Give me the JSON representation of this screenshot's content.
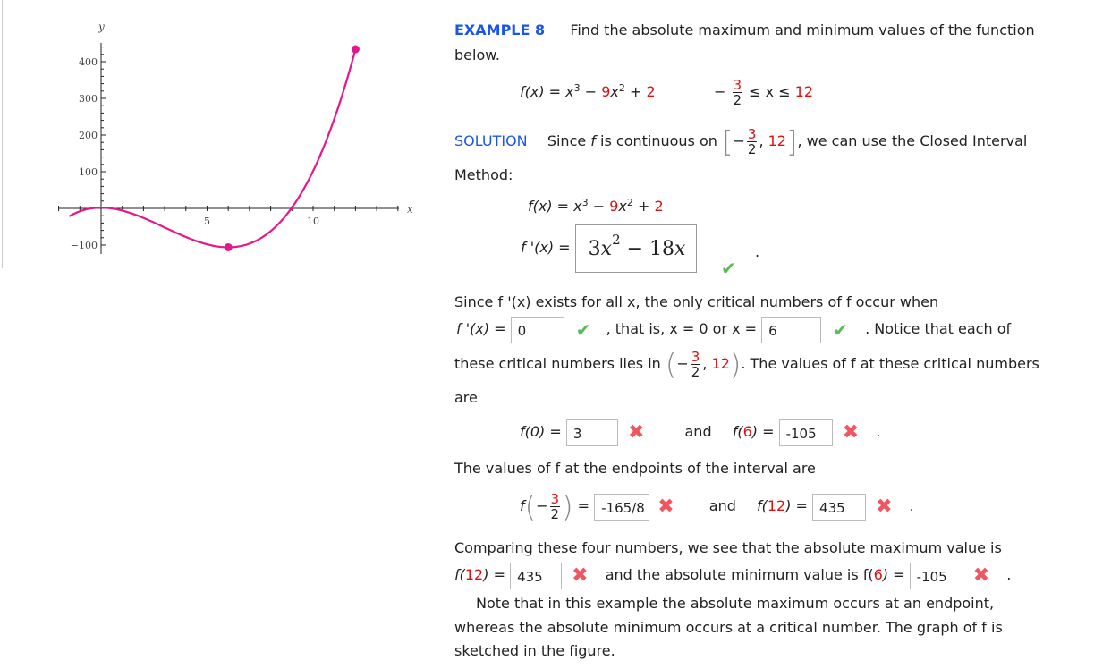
{
  "example": {
    "label": "EXAMPLE 8",
    "prompt_line1": "Find the absolute maximum and minimum values of the function",
    "prompt_line2": "below."
  },
  "function": {
    "lhs": "f(x) = x",
    "exp3": "3",
    "minus": " − ",
    "coef9": "9",
    "x": "x",
    "exp2": "2",
    "plus": " + ",
    "const2": "2",
    "domain_neg": "−",
    "frac_num": "3",
    "frac_den": "2",
    "domain_mid": "≤ x ≤ ",
    "domain_hi": "12"
  },
  "solution": {
    "label": "SOLUTION",
    "text1": "Since ",
    "f": "f",
    "text2": " is continuous on",
    "interval_open": "[",
    "interval_close": "]",
    "interval_hi": "12",
    "text3": ", we can use the Closed Interval",
    "text4": "Method:"
  },
  "derivative": {
    "fx_label": "f(x)",
    "fx_eq": " = ",
    "fprime_label": "f '(x)",
    "fprime_eq": " = ",
    "answer_coef": "3",
    "answer_x": "x",
    "answer_exp": "2",
    "answer_rest": " − 18",
    "answer_x2": "x",
    "status": "correct",
    "period": "."
  },
  "critical": {
    "line1": "Since  f '(x)  exists for all x, the only critical numbers of f occur when",
    "fprime_eq": "f '(x) = ",
    "input1_value": "0",
    "input1_status": "correct",
    "mid_text": ",  that is,  x = 0  or  x = ",
    "input2_value": "6",
    "input2_status": "correct",
    "tail_text": ".  Notice that each of",
    "line3a": "these critical numbers lies in",
    "open_paren": "(",
    "close_paren": ")",
    "interval_hi": "12",
    "line3b": ". The values of f at these critical numbers",
    "line4": "are"
  },
  "values": {
    "f0_label": "f(0) = ",
    "f0_value": "3",
    "f0_status": "incorrect",
    "and1": "and",
    "f6_label_pre": "f(",
    "f6_arg": "6",
    "f6_label_post": ") = ",
    "f6_value": "-105",
    "f6_status": "incorrect",
    "endpoints_text": "The values of f at the endpoints of the interval are",
    "fneg_value": "-165/8",
    "fneg_status": "incorrect",
    "and2": "and",
    "f12_pre": "f(",
    "f12_arg": "12",
    "f12_post": ") = ",
    "f12_value": "435",
    "f12_status": "incorrect"
  },
  "conclusion": {
    "line1": "Comparing these four numbers, we see that the absolute maximum value is",
    "max_pre": "f(",
    "max_arg": "12",
    "max_post": ") = ",
    "max_value": "435",
    "max_status": "incorrect",
    "mid": "and the absolute minimum value is  f(",
    "min_arg": "6",
    "min_post": ") = ",
    "min_value": "-105",
    "min_status": "incorrect",
    "note1": "Note that in this example the absolute maximum occurs at an endpoint,",
    "note2": "whereas the absolute minimum occurs at a critical number. The graph of f is",
    "note3": "sketched in the figure."
  },
  "symbols": {
    "check": "✔",
    "cross": "✖",
    "dot": "."
  },
  "colors": {
    "curve": "#e6168c",
    "accent_blue": "#1a56e8",
    "red": "#e01010",
    "check": "#5cb85c",
    "cross": "#f05560"
  },
  "chart_data": {
    "type": "line",
    "title": "",
    "function": "x^3 - 9x^2 + 2",
    "xlabel": "x",
    "ylabel": "y",
    "xlim": [
      -2,
      14
    ],
    "ylim": [
      -110,
      450
    ],
    "x_ticks": [
      5,
      10
    ],
    "y_ticks": [
      -100,
      100,
      200,
      300,
      400
    ],
    "domain": [
      -1.5,
      12
    ],
    "points": [
      {
        "x": 6,
        "y": -106,
        "label": "absolute minimum"
      },
      {
        "x": 12,
        "y": 434,
        "label": "absolute maximum"
      }
    ],
    "grid": false
  }
}
